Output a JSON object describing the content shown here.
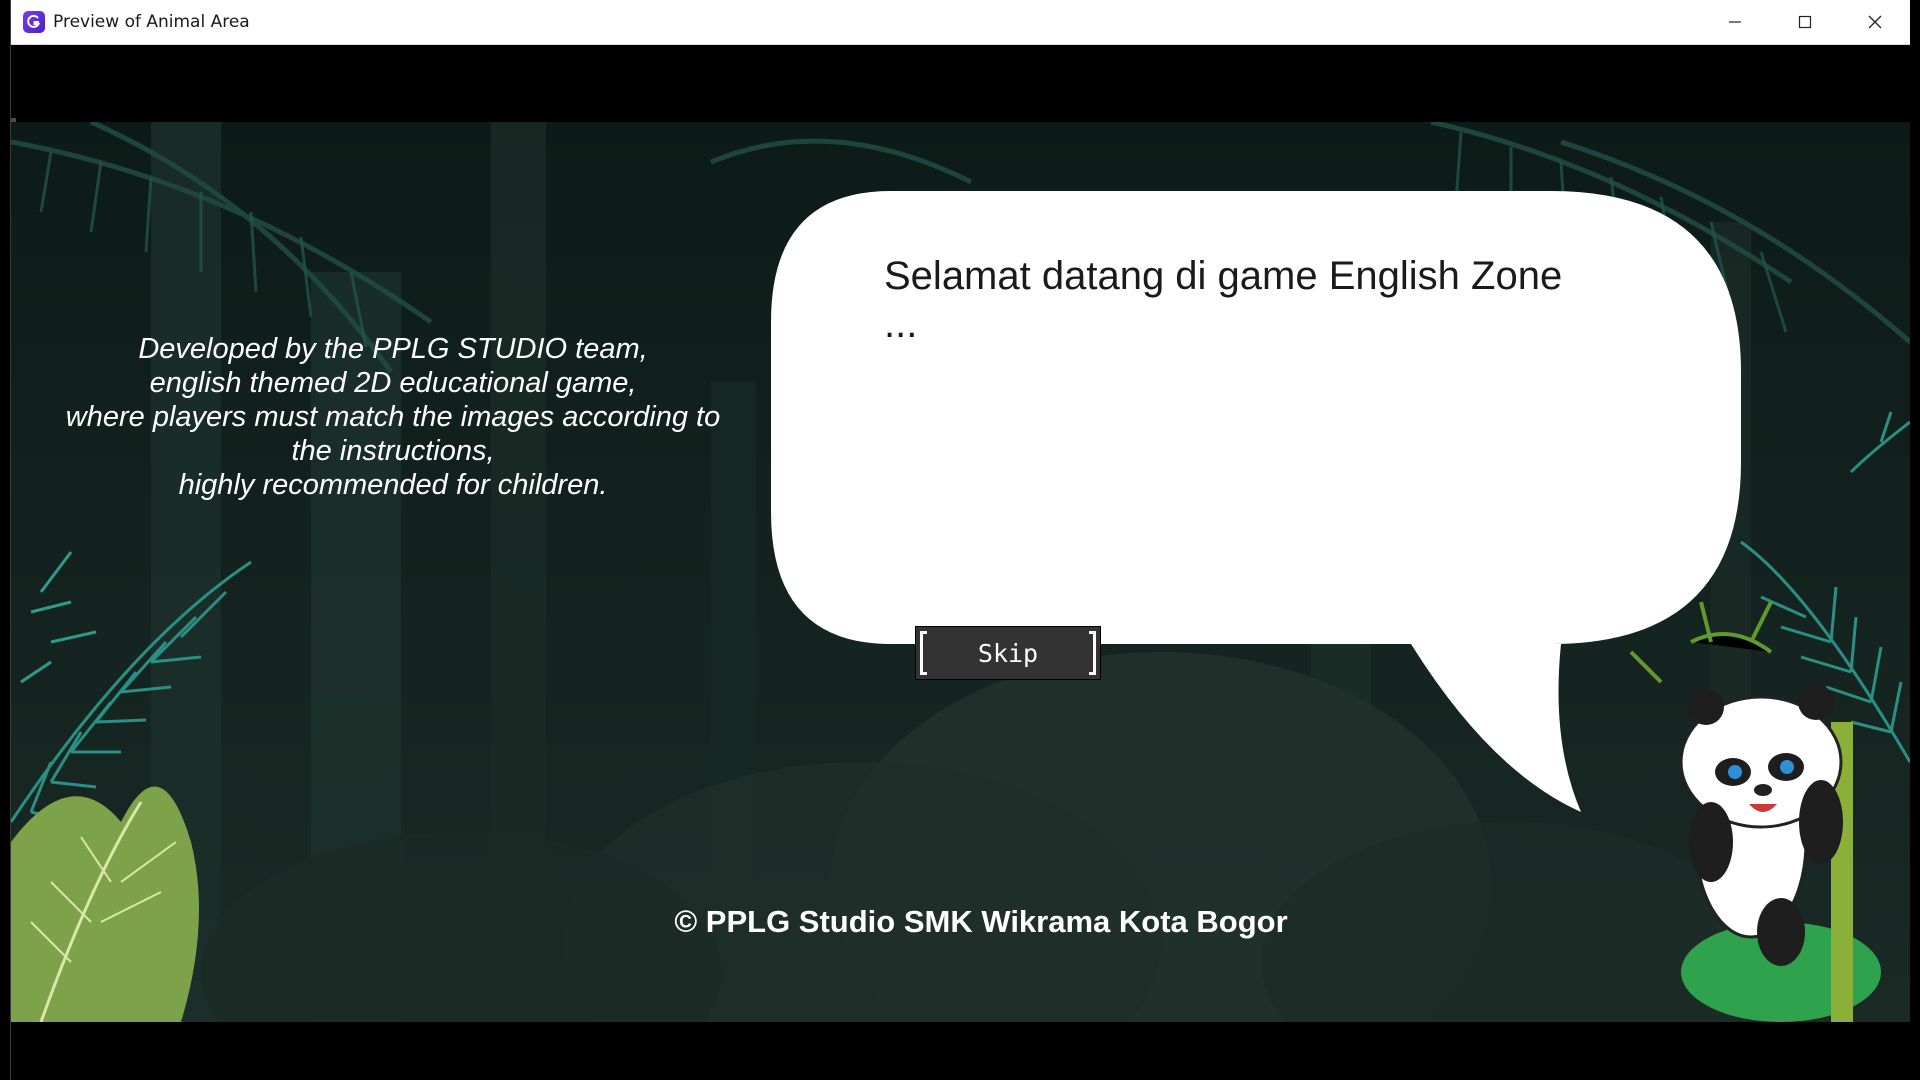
{
  "window": {
    "title": "Preview of Animal Area",
    "controls": [
      "minimize-icon",
      "maximize-icon",
      "close-icon"
    ]
  },
  "game": {
    "credits_lines": [
      "Developed by the PPLG STUDIO team,",
      "english themed 2D educational game,",
      "where players must match the images according to",
      "the instructions,",
      "highly recommended for children."
    ],
    "dialog_line1": "Selamat datang di game English Zone",
    "dialog_line2": "...",
    "skip_label": "Skip",
    "copyright": "© PPLG Studio SMK Wikrama Kota Bogor"
  },
  "colors": {
    "background": "#12211d",
    "bubble": "#ffffff",
    "button": "#333333",
    "accent": "#5b2ee0"
  }
}
